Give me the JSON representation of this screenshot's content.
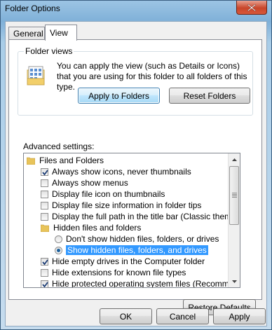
{
  "window": {
    "title": "Folder Options"
  },
  "tabs": [
    {
      "label": "General"
    },
    {
      "label": "View"
    }
  ],
  "folder_views": {
    "legend": "Folder views",
    "description": "You can apply the view (such as Details or Icons) that you are using for this folder to all folders of this type.",
    "apply_button": "Apply to Folders",
    "reset_button": "Reset Folders"
  },
  "advanced": {
    "label": "Advanced settings:",
    "items": [
      {
        "label": "Files and Folders",
        "kind": "folder",
        "level": 0
      },
      {
        "label": "Always show icons, never thumbnails",
        "kind": "checkbox",
        "checked": true,
        "level": 1
      },
      {
        "label": "Always show menus",
        "kind": "checkbox",
        "checked": false,
        "level": 1
      },
      {
        "label": "Display file icon on thumbnails",
        "kind": "checkbox",
        "checked": false,
        "level": 1
      },
      {
        "label": "Display file size information in folder tips",
        "kind": "checkbox",
        "checked": false,
        "level": 1
      },
      {
        "label": "Display the full path in the title bar (Classic theme only)",
        "kind": "checkbox",
        "checked": false,
        "level": 1
      },
      {
        "label": "Hidden files and folders",
        "kind": "folder",
        "level": 1
      },
      {
        "label": "Don't show hidden files, folders, or drives",
        "kind": "radio",
        "checked": false,
        "level": 2
      },
      {
        "label": "Show hidden files, folders, and drives",
        "kind": "radio",
        "checked": true,
        "selected": true,
        "level": 2
      },
      {
        "label": "Hide empty drives in the Computer folder",
        "kind": "checkbox",
        "checked": true,
        "level": 1
      },
      {
        "label": "Hide extensions for known file types",
        "kind": "checkbox",
        "checked": false,
        "level": 1
      },
      {
        "label": "Hide protected operating system files (Recommended)",
        "kind": "checkbox",
        "checked": true,
        "level": 1
      }
    ],
    "restore_button": "Restore Defaults"
  },
  "footer": {
    "ok_label": "OK",
    "cancel_label": "Cancel",
    "apply_label": "Apply"
  },
  "colors": {
    "selection": "#3399ff",
    "title_bar": "#9cc4e4",
    "close_button": "#c8452a"
  }
}
